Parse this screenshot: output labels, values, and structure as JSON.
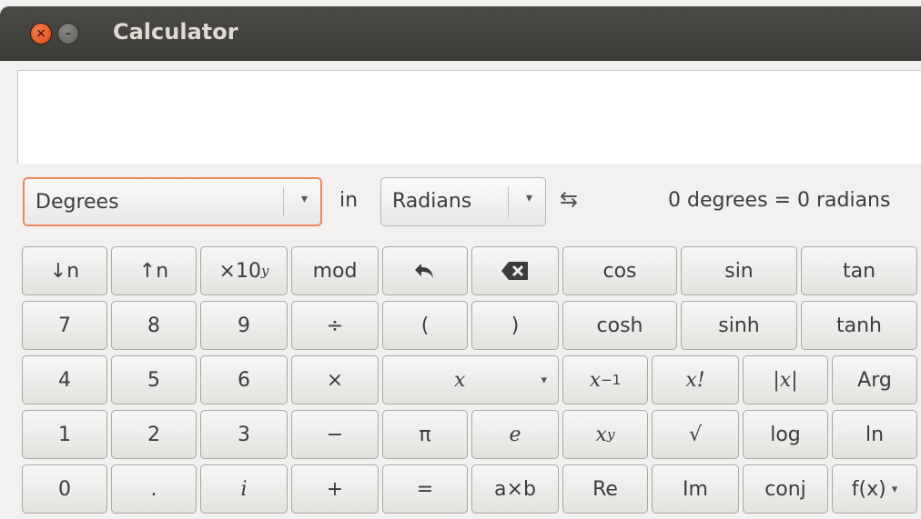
{
  "window": {
    "title": "Calculator"
  },
  "display": {
    "value": ""
  },
  "conversion": {
    "from_unit": "Degrees",
    "in_label": "in",
    "to_unit": "Radians",
    "swap_symbol": "⇆",
    "result": "0 degrees = 0 radians"
  },
  "icons": {
    "close": "×",
    "minimize": "–",
    "dropdown": "▾"
  },
  "keys": {
    "r1": [
      "↓n",
      "↑n",
      "×10",
      "y",
      "mod",
      "undo-icon",
      "backspace-icon",
      "cos",
      "sin",
      "tan"
    ],
    "shift_down": "↓n",
    "shift_up": "↑n",
    "exp_base": "×10",
    "exp_sup": "y",
    "mod": "mod",
    "cos": "cos",
    "sin": "sin",
    "tan": "tan",
    "seven": "7",
    "eight": "8",
    "nine": "9",
    "divide": "÷",
    "lparen": "(",
    "rparen": ")",
    "cosh": "cosh",
    "sinh": "sinh",
    "tanh": "tanh",
    "four": "4",
    "five": "5",
    "six": "6",
    "multiply": "×",
    "variable": "x",
    "inverse_base": "x",
    "inverse_sup": "−1",
    "factorial": "x!",
    "abs": "|x|",
    "arg": "Arg",
    "one": "1",
    "two": "2",
    "three": "3",
    "minus": "−",
    "pi": "π",
    "e": "e",
    "power_base": "x",
    "power_sup": "y",
    "sqrt": "√",
    "log": "log",
    "ln": "ln",
    "zero": "0",
    "dot": ".",
    "imag": "i",
    "plus": "+",
    "equals": "=",
    "axb": "a×b",
    "re": "Re",
    "im": "Im",
    "conj": "conj",
    "fx": "f(x)"
  }
}
